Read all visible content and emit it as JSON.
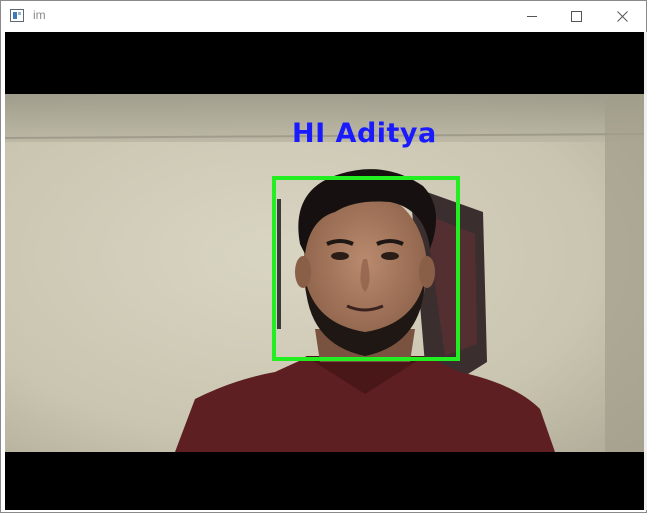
{
  "window": {
    "title": "im"
  },
  "overlay": {
    "greeting": "HI Aditya",
    "greeting_color": "#1a1aff",
    "face_box_color": "#22ee22"
  },
  "icons": {
    "app": "app-window-icon",
    "minimize": "minimize-icon",
    "maximize": "maximize-icon",
    "close": "close-icon"
  }
}
